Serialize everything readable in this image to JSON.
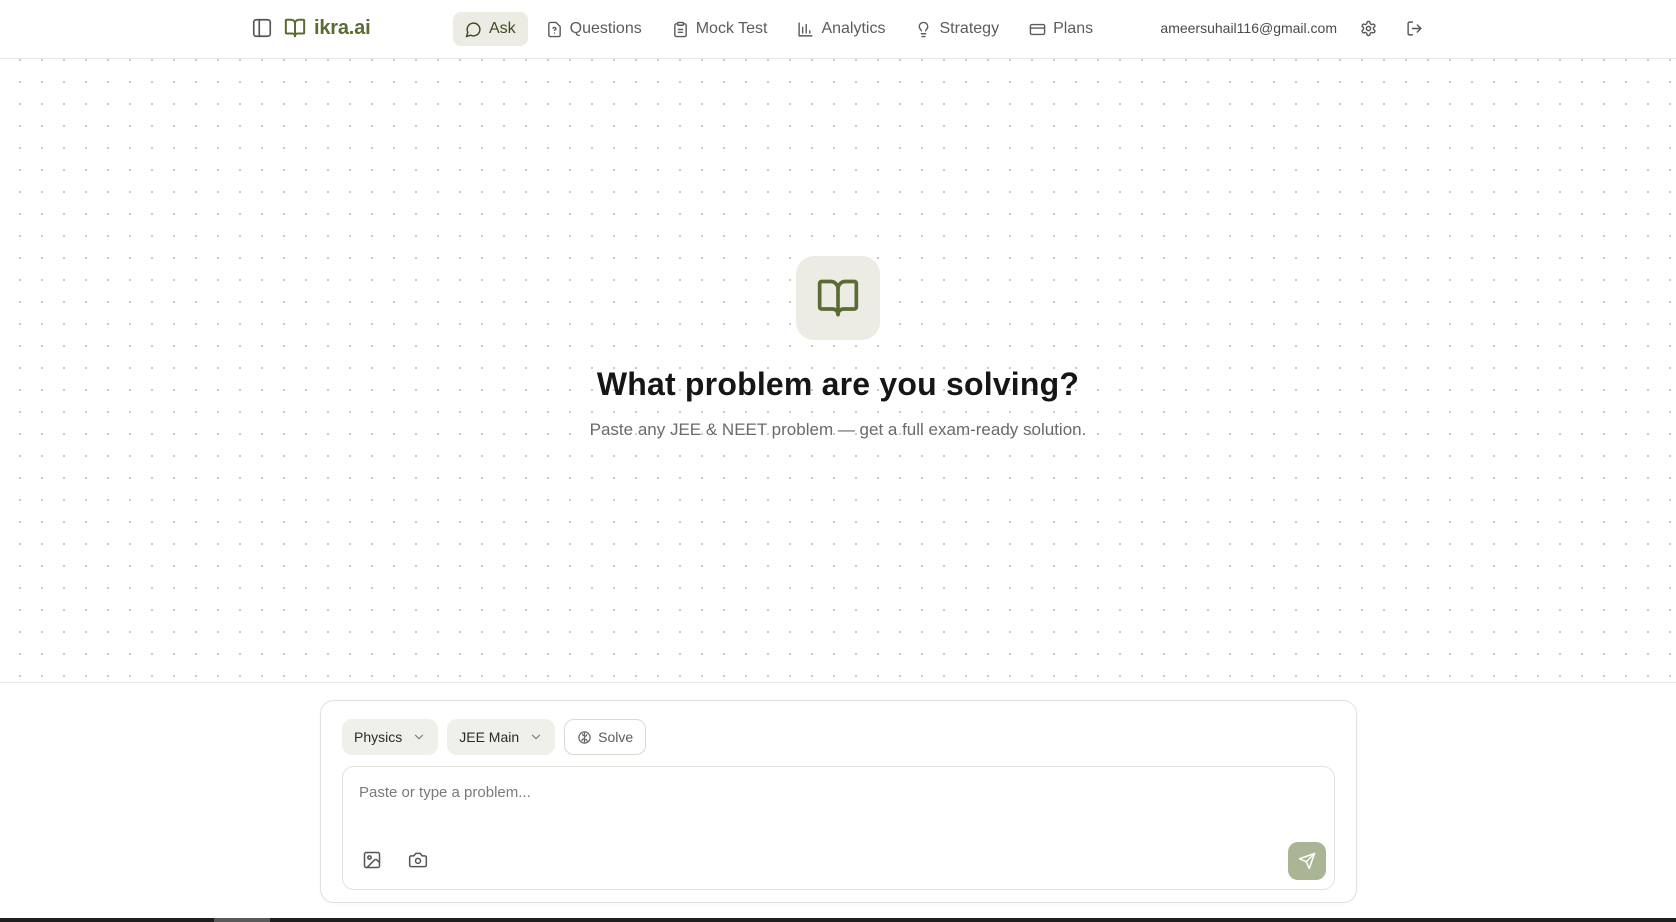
{
  "brand": {
    "name": "ikra.ai"
  },
  "nav": {
    "items": [
      {
        "label": "Ask",
        "icon": "message-circle-icon",
        "active": true
      },
      {
        "label": "Questions",
        "icon": "file-question-icon",
        "active": false
      },
      {
        "label": "Mock Test",
        "icon": "clipboard-icon",
        "active": false
      },
      {
        "label": "Analytics",
        "icon": "bar-chart-icon",
        "active": false
      },
      {
        "label": "Strategy",
        "icon": "lightbulb-icon",
        "active": false
      },
      {
        "label": "Plans",
        "icon": "credit-card-icon",
        "active": false
      }
    ]
  },
  "user": {
    "email": "ameersuhail116@gmail.com"
  },
  "hero": {
    "icon": "open-book-icon",
    "title": "What problem are you solving?",
    "subtitle": "Paste any JEE & NEET problem — get a full exam-ready solution."
  },
  "composer": {
    "subject": "Physics",
    "exam": "JEE Main",
    "mode": "Solve",
    "input_value": "",
    "input_placeholder": "Paste or type a problem..."
  },
  "colors": {
    "brand": "#5b6b34",
    "active_nav_bg": "#ecece4",
    "send_button": "#a9b595"
  }
}
